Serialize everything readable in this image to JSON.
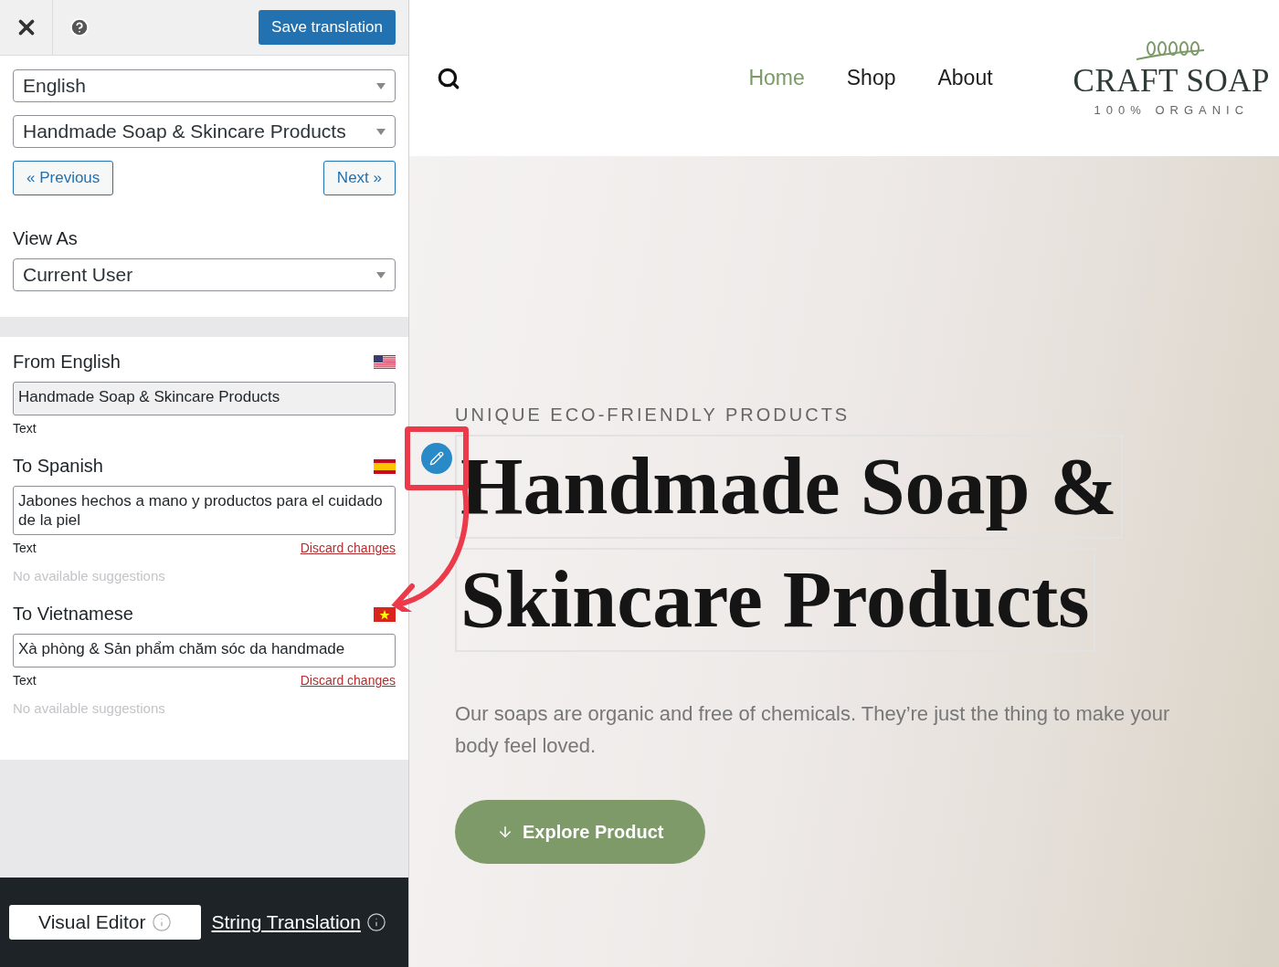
{
  "toolbar": {
    "save_button": "Save translation"
  },
  "language_select": {
    "value": "English"
  },
  "string_select": {
    "value": "Handmade Soap & Skincare Products"
  },
  "pager": {
    "previous": "« Previous",
    "next": "Next »"
  },
  "view_as": {
    "label": "View As",
    "value": "Current User"
  },
  "translations": [
    {
      "label": "From English",
      "kind": "us",
      "value": "Handmade Soap & Skincare Products",
      "disabled": true,
      "type": "Text"
    },
    {
      "label": "To Spanish",
      "kind": "es",
      "value": "Jabones hechos a mano y productos para el cuidado de la piel",
      "disabled": false,
      "type": "Text",
      "discard_link": "Discard changes",
      "suggestions": "No available suggestions"
    },
    {
      "label": "To Vietnamese",
      "kind": "vn",
      "value": "Xà phòng & Sản phẩm chăm sóc da handmade",
      "disabled": false,
      "type": "Text",
      "discard_link": "Discard changes",
      "suggestions": "No available suggestions"
    }
  ],
  "modes": [
    {
      "label": "Visual Editor",
      "selected": true
    },
    {
      "label": "String Translation",
      "selected": false
    }
  ],
  "site": {
    "nav": [
      {
        "label": "Home",
        "selected": true
      },
      {
        "label": "Shop",
        "selected": false
      },
      {
        "label": "About",
        "selected": false
      }
    ],
    "logo": {
      "name": "CRAFT SOAP",
      "tagline": "100% ORGANIC"
    },
    "hero": {
      "eyebrow": "UNIQUE ECO-FRIENDLY PRODUCTS",
      "title_lines": [
        "Handmade Soap &",
        "Skincare Products"
      ],
      "body": "Our soaps are organic and free of chemicals. They’re just the thing to make your body feel loved.",
      "cta": "Explore Product"
    }
  }
}
